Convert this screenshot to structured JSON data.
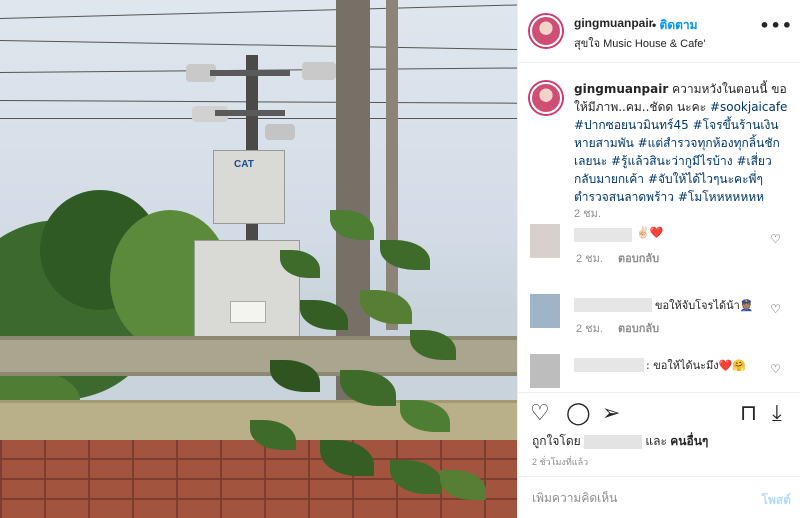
{
  "post": {
    "header": {
      "username": "gingmuanpair",
      "separator": "•",
      "follow_label": "ติดตาม",
      "location": "สุขใจ Music House & Cafe'",
      "more_icon": "more-horizontal-icon"
    },
    "caption": {
      "username": "gingmuanpair",
      "text_parts": [
        {
          "text": " ความหวังในตอนนี้ ขอให้มีภาพ..คม..ชัดด นะคะ ",
          "tag": false
        },
        {
          "text": "#sookjaicafe",
          "tag": true
        },
        {
          "text": " ",
          "tag": false
        },
        {
          "text": "#ปากซอยนวมินทร์45",
          "tag": true
        },
        {
          "text": " ",
          "tag": false
        },
        {
          "text": "#โจรขึ้นร้านเงินหายสามพัน",
          "tag": true
        },
        {
          "text": " ",
          "tag": false
        },
        {
          "text": "#แต่สำรวจทุกห้องทุกลิ้นชักเลยนะ",
          "tag": true
        },
        {
          "text": " ",
          "tag": false
        },
        {
          "text": "#รู้แล้วสินะว่ากูมีไรบ้าง",
          "tag": true
        },
        {
          "text": " ",
          "tag": false
        },
        {
          "text": "#เสี่ยวกลับมายกเค้า",
          "tag": true
        },
        {
          "text": " ",
          "tag": false
        },
        {
          "text": "#จับให้ได้ไวๆนะคะพี่ๆตำรวจสนลาดพร้าว",
          "tag": true
        },
        {
          "text": " ",
          "tag": false
        },
        {
          "text": "#โมโหหหหหหห",
          "tag": true
        }
      ],
      "time": "2 ชม."
    },
    "comments": [
      {
        "text": "✌🏻❤️",
        "time": "2 ชม.",
        "reply_label": "ตอบกลับ",
        "avatar_color": "#d8d0cc"
      },
      {
        "text": "ขอให้จับโจรได้น้า👮🏽",
        "time": "2 ชม.",
        "reply_label": "ตอบกลับ",
        "avatar_color": "#9fb4c7"
      },
      {
        "text": ": ขอให้ได้นะมึง❤️🤗",
        "time": "",
        "reply_label": "",
        "avatar_color": "#bdbdbd"
      }
    ],
    "likes": {
      "prefix": "ถูกใจโดย",
      "and": "และ",
      "others": "คนอื่นๆ"
    },
    "date": "2 ชั่วโมงที่แล้ว",
    "add_comment": {
      "placeholder": "เพิ่มความคิดเห็น",
      "post_label": "โพสต์"
    },
    "photo": {
      "cabinet_logo": "CAT",
      "cabinet_label": "CAT"
    },
    "colors": {
      "link": "#0095f6",
      "hashtag": "#00376b",
      "muted": "#8e8e8e",
      "heart_red": "#ed4956"
    },
    "icons": [
      "heart-icon",
      "comment-icon",
      "share-icon",
      "bookmark-icon",
      "download-icon"
    ]
  }
}
